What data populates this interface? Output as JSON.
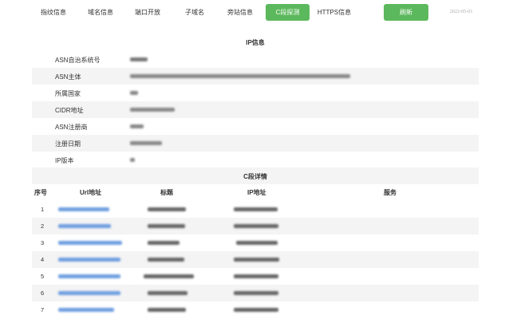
{
  "tabs": [
    {
      "label": "指纹信息",
      "active": false
    },
    {
      "label": "域名信息",
      "active": false
    },
    {
      "label": "端口开放",
      "active": false
    },
    {
      "label": "子域名",
      "active": false
    },
    {
      "label": "旁站信息",
      "active": false
    },
    {
      "label": "C段探测",
      "active": true
    },
    {
      "label": "HTTPS信息",
      "active": false
    }
  ],
  "refresh_label": "刷新",
  "date": "2022-05-03",
  "ip_section": {
    "title": "IP信息",
    "rows": [
      {
        "label": "ASN自治系统号"
      },
      {
        "label": "ASN主体"
      },
      {
        "label": "所属国家"
      },
      {
        "label": "CIDR地址"
      },
      {
        "label": "ASN注册商"
      },
      {
        "label": "注册日期"
      },
      {
        "label": "IP版本"
      }
    ]
  },
  "c_section": {
    "title": "C段详情",
    "headers": {
      "index": "序号",
      "url": "Url地址",
      "title": "标题",
      "ip": "IP地址",
      "service": "服务"
    },
    "rows": [
      {
        "index": "1"
      },
      {
        "index": "2"
      },
      {
        "index": "3"
      },
      {
        "index": "4"
      },
      {
        "index": "5"
      },
      {
        "index": "6"
      },
      {
        "index": "7"
      }
    ]
  },
  "colors": {
    "accent": "#5cb85c",
    "link": "#3a7bd5",
    "stripe": "#f4f4f4",
    "blurred_text": "#555555"
  }
}
